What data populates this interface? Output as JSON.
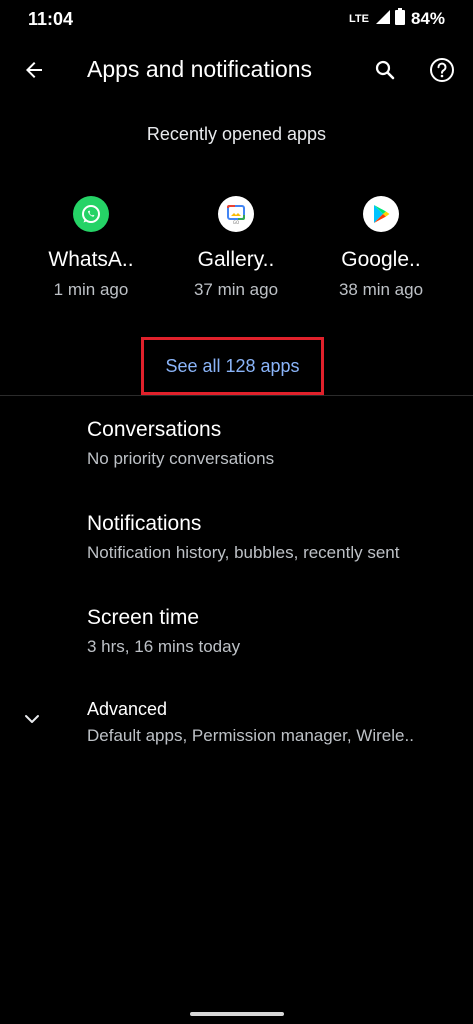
{
  "status_bar": {
    "time": "11:04",
    "network": "LTE",
    "battery": "84%"
  },
  "app_bar": {
    "title": "Apps and notifications",
    "icons": {
      "back": "arrow-back-icon",
      "search": "search-icon",
      "help": "help-icon"
    }
  },
  "recent": {
    "header": "Recently opened apps",
    "apps": [
      {
        "name": "WhatsA..",
        "time": "1 min ago",
        "icon": "whatsapp-icon",
        "color": "#25d366"
      },
      {
        "name": "Gallery..",
        "time": "37 min ago",
        "icon": "gallery-go-icon",
        "color": "#ffffff"
      },
      {
        "name": "Google..",
        "time": "38 min ago",
        "icon": "google-play-icon",
        "color": "#ffffff"
      }
    ],
    "see_all": "See all 128 apps"
  },
  "menu": {
    "items": [
      {
        "title": "Conversations",
        "summary": "No priority conversations"
      },
      {
        "title": "Notifications",
        "summary": "Notification history, bubbles, recently sent"
      },
      {
        "title": "Screen time",
        "summary": "3 hrs, 16 mins today"
      }
    ],
    "advanced": {
      "title": "Advanced",
      "summary": "Default apps, Permission manager, Wirele..",
      "icon": "chevron-down-icon"
    }
  },
  "colors": {
    "background": "#000000",
    "accent_link": "#8ab4f8",
    "highlight_box": "#e0212b"
  }
}
